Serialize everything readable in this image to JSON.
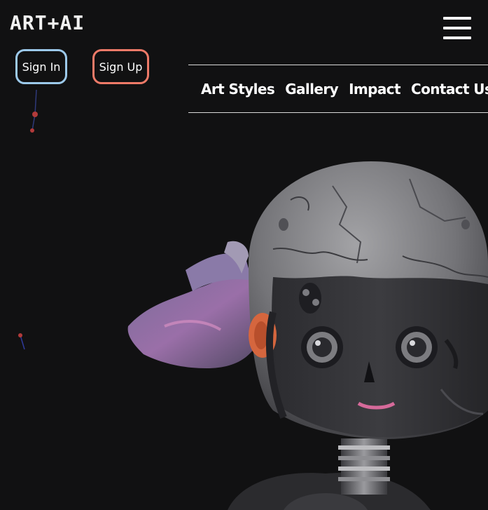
{
  "header": {
    "logo": "ART+AI",
    "menu_icon": "hamburger-menu-icon"
  },
  "auth": {
    "sign_in_label": "Sign In",
    "sign_up_label": "Sign Up",
    "sign_in_color": "#9cc9ea",
    "sign_up_color": "#ee7a68"
  },
  "nav": {
    "items": [
      {
        "label": "Art Styles"
      },
      {
        "label": "Gallery"
      },
      {
        "label": "Impact"
      },
      {
        "label": "Contact Us"
      }
    ]
  },
  "hero": {
    "image": "robot-head-illustration",
    "background_color": "#111112"
  }
}
